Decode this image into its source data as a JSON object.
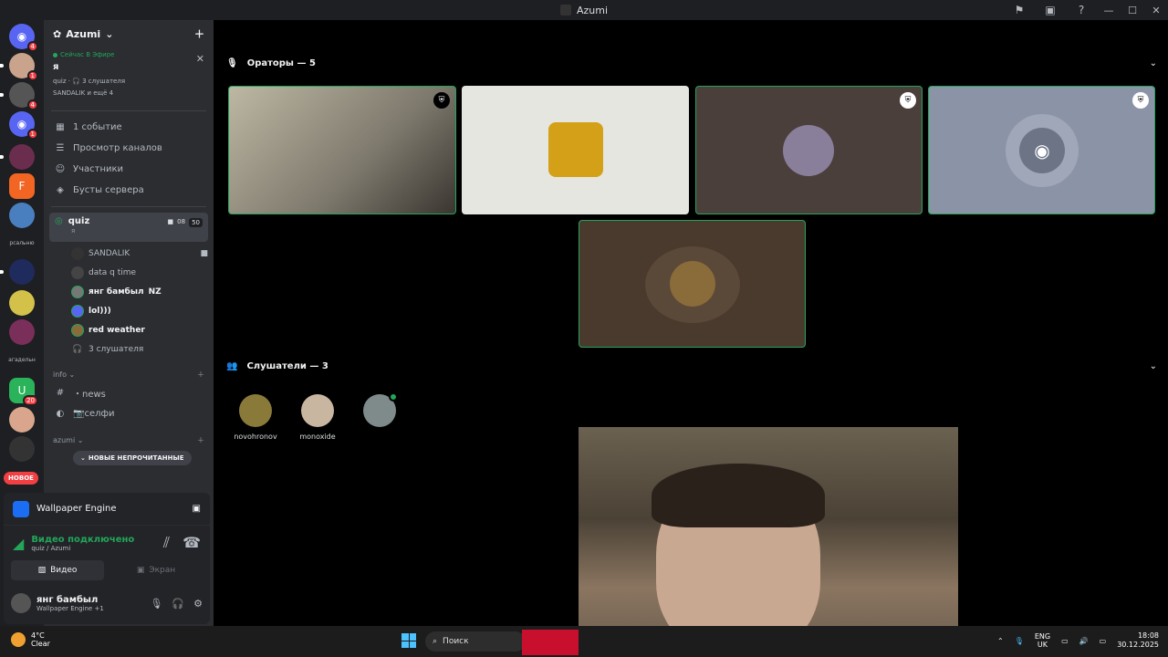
{
  "window": {
    "title": "Azumi"
  },
  "rail": {
    "badges": [
      "4",
      "1",
      "4",
      "1",
      "20"
    ],
    "labels": [
      "рсальню",
      "агадельн"
    ],
    "new_label": "НОВОЕ"
  },
  "sidebar": {
    "guild_name": "Azumi",
    "live": {
      "label": "Сейчас В Эфире",
      "title": "я",
      "meta": "quiz · 🎧 3 слушателя",
      "participants": "SANDALIK и ещё 4"
    },
    "nav": [
      {
        "label": "1 событие",
        "icon": "calendar-icon"
      },
      {
        "label": "Просмотр каналов",
        "icon": "browse-icon"
      },
      {
        "label": "Участники",
        "icon": "members-icon"
      },
      {
        "label": "Бусты сервера",
        "icon": "boost-icon"
      }
    ],
    "voice_channel": {
      "name": "quiz",
      "sub": "я",
      "badge_time": "08",
      "badge_limit": "50"
    },
    "members": [
      {
        "name": "SANDALIK"
      },
      {
        "name": "data q time"
      },
      {
        "name": "янг бамбыл",
        "tag": "NZ"
      },
      {
        "name": "lol)))"
      },
      {
        "name": "red weather"
      },
      {
        "name": "3 слушателя"
      }
    ],
    "categories": [
      {
        "name": "info",
        "channels": [
          "・news",
          "📷селфи"
        ]
      },
      {
        "name": "azumi",
        "channels": []
      }
    ],
    "unread_pill": "НОВЫЕ НЕПРОЧИТАННЫЕ"
  },
  "panel": {
    "app_name": "Wallpaper Engine",
    "video_status": "Видео подключено",
    "video_path": "quiz / Azumi",
    "video_btn": "Видео",
    "screen_btn": "Экран",
    "user_name": "янг бамбыл",
    "user_status": "Wallpaper Engine +1"
  },
  "stage": {
    "speakers_header": "Ораторы — 5",
    "listeners_header": "Слушатели — 3",
    "listeners": [
      {
        "name": "novohronov"
      },
      {
        "name": "monoxide"
      },
      {
        "name": ""
      }
    ]
  },
  "taskbar": {
    "temp": "4°C",
    "condition": "Clear",
    "search_placeholder": "Поиск",
    "lang_top": "ENG",
    "lang_bottom": "UK",
    "time": "18:08",
    "date": "30.12.2025"
  }
}
